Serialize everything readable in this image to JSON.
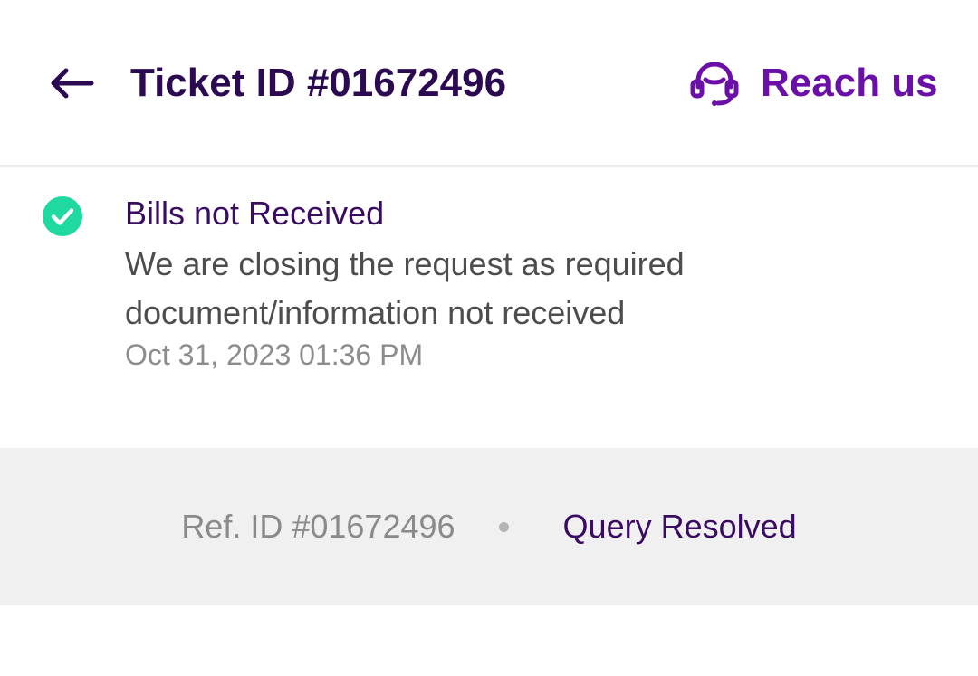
{
  "header": {
    "title": "Ticket ID #01672496",
    "reach_us_label": "Reach us",
    "back_icon": "arrow-left-icon",
    "reach_us_icon": "headset-icon"
  },
  "status": {
    "icon": "check-circle-icon",
    "title": "Bills not Received",
    "message": "We are closing the request as required document/information not received",
    "timestamp": "Oct 31, 2023 01:36 PM"
  },
  "footer": {
    "ref_id": "Ref. ID #01672496",
    "query_status": "Query Resolved"
  },
  "colors": {
    "title": "#2b0a52",
    "accent": "#6a0fa8",
    "success": "#1fd9a0",
    "muted": "#8c8c8c",
    "band": "#f0f0f0"
  }
}
